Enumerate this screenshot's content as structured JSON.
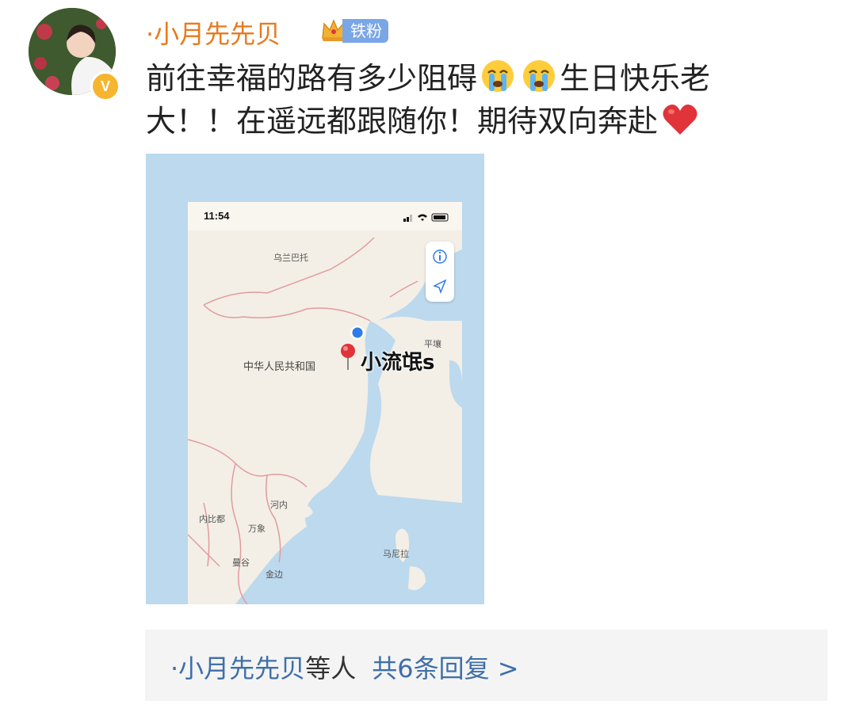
{
  "post": {
    "username": "·小月先先贝",
    "fan_badge": "铁粉",
    "verified_mark": "V",
    "line1_a": "前往幸福的路有多少阻碍",
    "line1_b": "生日快乐老",
    "line2": "大！！在遥远都跟随你！期待双向奔赴",
    "icons": [
      "avatar",
      "verified-badge-icon",
      "crown-icon",
      "crying-face-emoji",
      "red-heart-emoji"
    ]
  },
  "map": {
    "status_time": "11:54",
    "labels": {
      "urumqi": "乌兰巴托",
      "pyongyang": "平壤",
      "country": "中华人民共和国",
      "hanoi": "河内",
      "naypyidaw": "内比都",
      "vientiane": "万象",
      "bangkok": "曼谷",
      "phnom_penh": "金边",
      "manila": "马尼拉"
    },
    "pin_label": "小流氓s",
    "colors": {
      "sea": "#bcd9ee",
      "land": "#f3efe6",
      "border": "#e29aa0",
      "pin": "#e0343a",
      "location": "#2f7bea"
    }
  },
  "reply": {
    "dot": "·",
    "users": "小月先先贝",
    "others": "等人",
    "count_text": "共6条回复 >"
  },
  "colors": {
    "username": "#e87a1d",
    "link": "#3f6fa8",
    "reply_bg": "#f4f4f4",
    "badge": "#7aa6e6",
    "verified": "#f5b52e"
  }
}
